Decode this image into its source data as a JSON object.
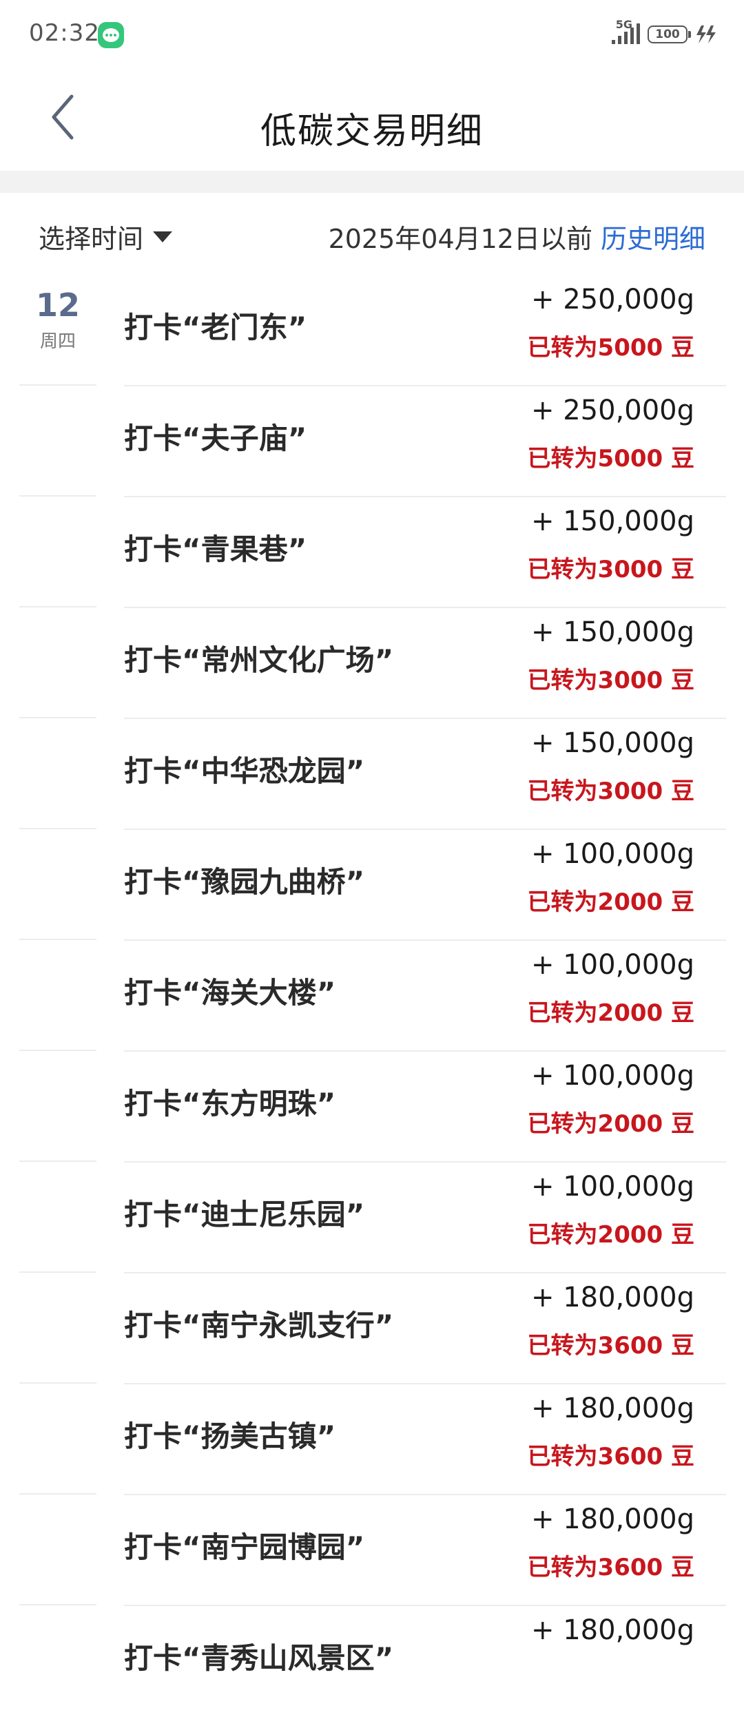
{
  "status_bar": {
    "time": "02:32",
    "network": "5G",
    "battery": "100"
  },
  "header": {
    "title": "低碳交易明细"
  },
  "filter": {
    "select_label": "选择时间",
    "date_text": "2025年04月12日以前",
    "history_link": "历史明细"
  },
  "date_group": {
    "day": "12",
    "weekday": "周四"
  },
  "transactions": [
    {
      "name": "打卡“老门东”",
      "amount": "+ 250,000g",
      "converted": "已转为5000 豆"
    },
    {
      "name": "打卡“夫子庙”",
      "amount": "+ 250,000g",
      "converted": "已转为5000 豆"
    },
    {
      "name": "打卡“青果巷”",
      "amount": "+ 150,000g",
      "converted": "已转为3000 豆"
    },
    {
      "name": "打卡“常州文化广场”",
      "amount": "+ 150,000g",
      "converted": "已转为3000 豆"
    },
    {
      "name": "打卡“中华恐龙园”",
      "amount": "+ 150,000g",
      "converted": "已转为3000 豆"
    },
    {
      "name": "打卡“豫园九曲桥”",
      "amount": "+ 100,000g",
      "converted": "已转为2000 豆"
    },
    {
      "name": "打卡“海关大楼”",
      "amount": "+ 100,000g",
      "converted": "已转为2000 豆"
    },
    {
      "name": "打卡“东方明珠”",
      "amount": "+ 100,000g",
      "converted": "已转为2000 豆"
    },
    {
      "name": "打卡“迪士尼乐园”",
      "amount": "+ 100,000g",
      "converted": "已转为2000 豆"
    },
    {
      "name": "打卡“南宁永凯支行”",
      "amount": "+ 180,000g",
      "converted": "已转为3600 豆"
    },
    {
      "name": "打卡“扬美古镇”",
      "amount": "+ 180,000g",
      "converted": "已转为3600 豆"
    },
    {
      "name": "打卡“南宁园博园”",
      "amount": "+ 180,000g",
      "converted": "已转为3600 豆"
    },
    {
      "name": "打卡“青秀山风景区”",
      "amount": "+ 180,000g",
      "converted": ""
    }
  ],
  "colors": {
    "converted_red": "#c8161d",
    "link_blue": "#2b6bd6",
    "date_slate": "#5a6b8c"
  }
}
